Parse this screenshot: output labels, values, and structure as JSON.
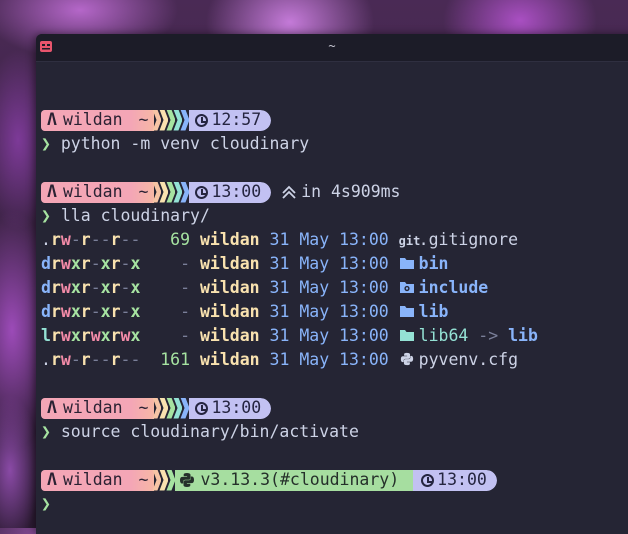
{
  "window": {
    "title": "~"
  },
  "user": "wildan",
  "dir": "~",
  "blocks": [
    {
      "time": "12:57",
      "command": "python -m venv cloudinary"
    },
    {
      "time": "13:00",
      "duration": "in 4s909ms",
      "command": "lla cloudinary/"
    },
    {
      "time": "13:00",
      "command": "source cloudinary/bin/activate"
    },
    {
      "time": "13:00",
      "python": "v3.13.3(#cloudinary)",
      "command": ""
    }
  ],
  "listing": [
    {
      "perm": ".rw-r--r--",
      "size": "69",
      "user": "wildan",
      "date": "31 May 13:00",
      "icon": "git-icon",
      "name": ".gitignore",
      "kind": "file"
    },
    {
      "perm": "drwxr-xr-x",
      "size": "-",
      "user": "wildan",
      "date": "31 May 13:00",
      "icon": "folder-icon",
      "name": "bin",
      "kind": "dir"
    },
    {
      "perm": "drwxr-xr-x",
      "size": "-",
      "user": "wildan",
      "date": "31 May 13:00",
      "icon": "include-folder-icon",
      "name": "include",
      "kind": "dir"
    },
    {
      "perm": "drwxr-xr-x",
      "size": "-",
      "user": "wildan",
      "date": "31 May 13:00",
      "icon": "folder-icon",
      "name": "lib",
      "kind": "dir"
    },
    {
      "perm": "lrwxrwxrwx",
      "size": "-",
      "user": "wildan",
      "date": "31 May 13:00",
      "icon": "folder-link-icon",
      "name": "lib64",
      "arrow": "->",
      "target": "lib",
      "kind": "link"
    },
    {
      "perm": ".rw-r--r--",
      "size": "161",
      "user": "wildan",
      "date": "31 May 13:00",
      "icon": "python-icon",
      "name": "pyvenv.cfg",
      "kind": "file"
    }
  ],
  "prompt_char": "❯",
  "git_label": "git",
  "colors": {
    "user_seg": "#f4a6b6",
    "python_seg": "#a6dea0",
    "time_seg": "#c2c1f2",
    "caret": "#a6e3a1"
  }
}
